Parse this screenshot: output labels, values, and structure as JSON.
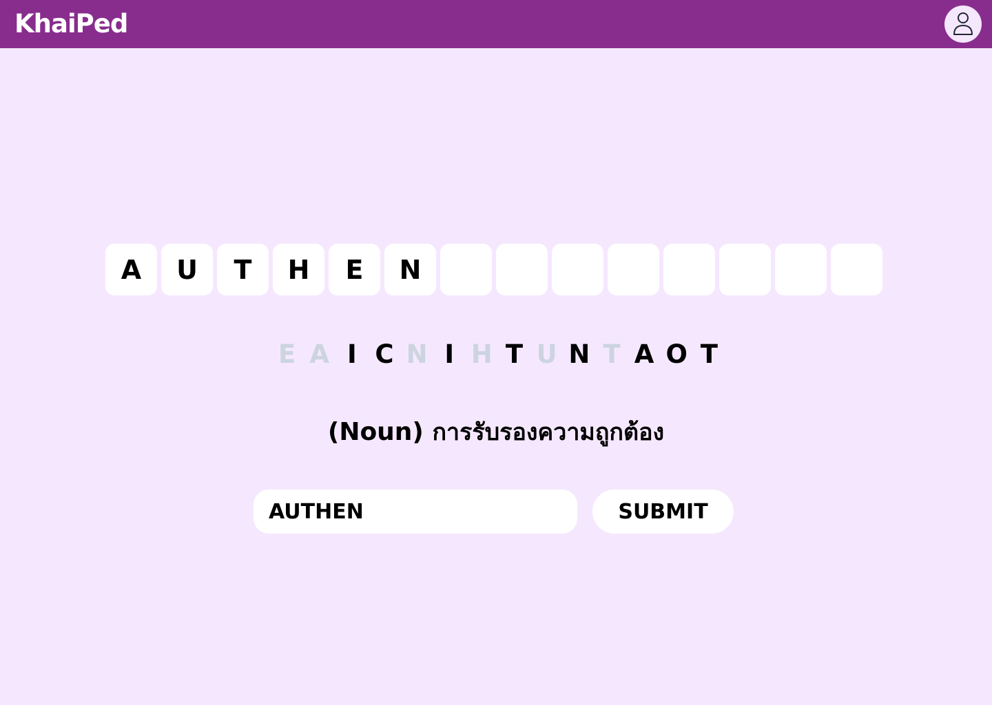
{
  "header": {
    "logo_text": "KhaiPed",
    "avatar_icon": "user-icon",
    "bar_color": "#882d8d"
  },
  "game": {
    "answer_length": 14,
    "filled_letters": [
      "A",
      "U",
      "T",
      "H",
      "E",
      "N",
      "",
      "",
      "",
      "",
      "",
      "",
      "",
      ""
    ],
    "letter_pool": [
      {
        "letter": "E",
        "used": true
      },
      {
        "letter": "A",
        "used": true
      },
      {
        "letter": "I",
        "used": false
      },
      {
        "letter": "C",
        "used": false
      },
      {
        "letter": "N",
        "used": true
      },
      {
        "letter": "I",
        "used": false
      },
      {
        "letter": "H",
        "used": true
      },
      {
        "letter": "T",
        "used": false
      },
      {
        "letter": "U",
        "used": true
      },
      {
        "letter": "N",
        "used": false
      },
      {
        "letter": "T",
        "used": true
      },
      {
        "letter": "A",
        "used": false
      },
      {
        "letter": "O",
        "used": false
      },
      {
        "letter": "T",
        "used": false
      }
    ],
    "definition": {
      "part_of_speech": "(Noun)",
      "meaning": "การรับรองความถูกต้อง"
    },
    "answer_input": {
      "value": "AUTHEN",
      "placeholder": ""
    },
    "submit_label": "SUBMIT"
  },
  "colors": {
    "background": "#f5e8fe",
    "used_letter": "#ccd4e0",
    "available_letter": "#000000",
    "tile": "#ffffff"
  }
}
